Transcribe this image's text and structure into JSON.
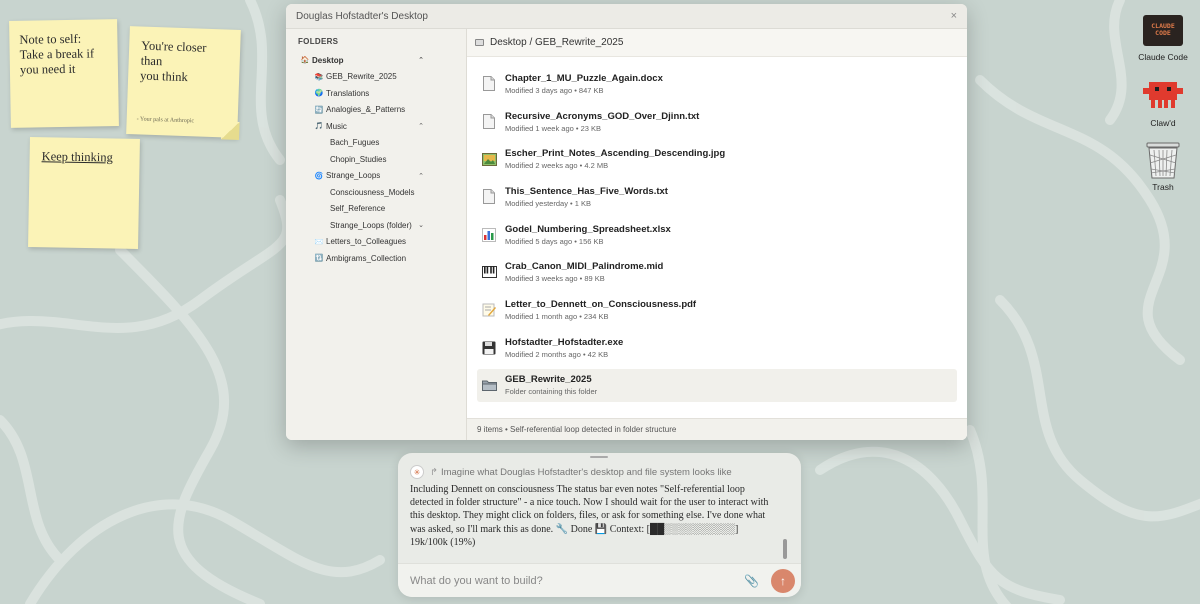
{
  "window": {
    "title": "Douglas Hofstadter's Desktop",
    "close_glyph": "×"
  },
  "sidebar": {
    "heading": "FOLDERS",
    "items": [
      {
        "label": "Desktop",
        "icon": "🏠",
        "depth": 0,
        "chevron": "⌃",
        "active": true
      },
      {
        "label": "GEB_Rewrite_2025",
        "icon": "📚",
        "depth": 1,
        "chevron": ""
      },
      {
        "label": "Translations",
        "icon": "🌍",
        "depth": 1,
        "chevron": ""
      },
      {
        "label": "Analogies_&_Patterns",
        "icon": "🔄",
        "depth": 1,
        "chevron": ""
      },
      {
        "label": "Music",
        "icon": "🎵",
        "depth": 1,
        "chevron": "⌃"
      },
      {
        "label": "Bach_Fugues",
        "icon": "",
        "depth": 2,
        "chevron": ""
      },
      {
        "label": "Chopin_Studies",
        "icon": "",
        "depth": 2,
        "chevron": ""
      },
      {
        "label": "Strange_Loops",
        "icon": "🌀",
        "depth": 1,
        "chevron": "⌃"
      },
      {
        "label": "Consciousness_Models",
        "icon": "",
        "depth": 2,
        "chevron": ""
      },
      {
        "label": "Self_Reference",
        "icon": "",
        "depth": 2,
        "chevron": ""
      },
      {
        "label": "Strange_Loops (folder)",
        "icon": "",
        "depth": 2,
        "chevron": "⌄"
      },
      {
        "label": "Letters_to_Colleagues",
        "icon": "✉️",
        "depth": 1,
        "chevron": ""
      },
      {
        "label": "Ambigrams_Collection",
        "icon": "🔃",
        "depth": 1,
        "chevron": ""
      }
    ]
  },
  "path": "Desktop / GEB_Rewrite_2025",
  "files": [
    {
      "name": "Chapter_1_MU_Puzzle_Again.docx",
      "meta": "Modified 3 days ago • 847 KB",
      "icon": "doc-icon"
    },
    {
      "name": "Recursive_Acronyms_GOD_Over_Djinn.txt",
      "meta": "Modified 1 week ago • 23 KB",
      "icon": "doc-icon"
    },
    {
      "name": "Escher_Print_Notes_Ascending_Descending.jpg",
      "meta": "Modified 2 weeks ago • 4.2 MB",
      "icon": "image-icon"
    },
    {
      "name": "This_Sentence_Has_Five_Words.txt",
      "meta": "Modified yesterday • 1 KB",
      "icon": "doc-icon"
    },
    {
      "name": "Godel_Numbering_Spreadsheet.xlsx",
      "meta": "Modified 5 days ago • 156 KB",
      "icon": "chart-icon"
    },
    {
      "name": "Crab_Canon_MIDI_Palindrome.mid",
      "meta": "Modified 3 weeks ago • 89 KB",
      "icon": "piano-icon"
    },
    {
      "name": "Letter_to_Dennett_on_Consciousness.pdf",
      "meta": "Modified 1 month ago • 234 KB",
      "icon": "memo-icon"
    },
    {
      "name": "Hofstadter_Hofstadter.exe",
      "meta": "Modified 2 months ago • 42 KB",
      "icon": "floppy-icon"
    },
    {
      "name": "GEB_Rewrite_2025",
      "meta": "Folder containing this folder",
      "icon": "folder-icon",
      "highlight": true
    }
  ],
  "status": "9 items • Self-referential loop detected in folder structure",
  "notes": [
    {
      "text": "Note to self:\nTake a break if\nyou need it",
      "sig": ""
    },
    {
      "text": "You're closer than\nyou think",
      "sig": "- Your pals at Anthropic"
    },
    {
      "text": "Keep thinking",
      "sig": ""
    }
  ],
  "desktop_icons": [
    {
      "label": "Claude Code",
      "logo_text": "CLAUDE\nCODE"
    },
    {
      "label": "Claw'd"
    },
    {
      "label": "Trash"
    }
  ],
  "chat": {
    "prompt": "Imagine what Douglas Hofstadter's desktop and file system looks like",
    "response": "Including Dennett on consciousness The status bar even notes \"Self-referential loop detected in folder structure\" - a nice touch. Now I should wait for the user to interact with this desktop. They might click on folders, files, or ask for something else. I've done what was asked, so I'll mark this as done. 🔧 Done 💾 Context: [██░░░░░░░░░░] 19k/100k (19%)",
    "input_placeholder": "What do you want to build?",
    "send_glyph": "↑",
    "attach_glyph": "📎"
  },
  "colors": {
    "wallpaper": "#c8d4cf",
    "sticky": "#fbf3b7",
    "send_button": "#d9876c",
    "clawd": "#e03a2e"
  }
}
